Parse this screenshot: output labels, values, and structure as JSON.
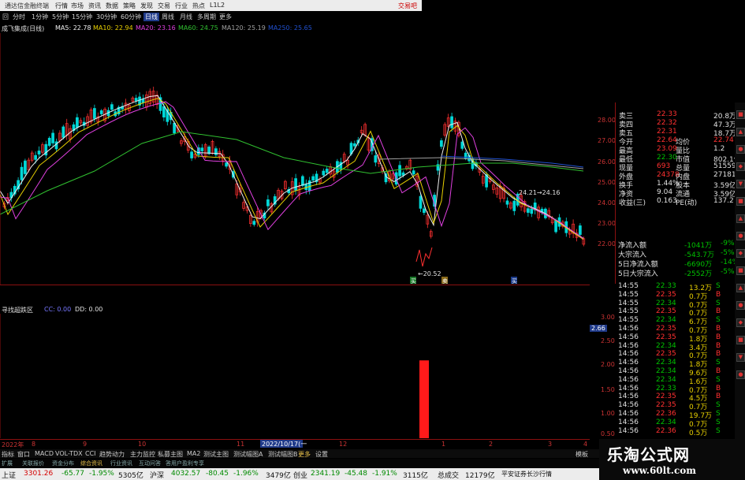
{
  "app": {
    "title": "通达信金融终端",
    "brand": "交易吧"
  },
  "menu": [
    "行情",
    "市场",
    "资讯",
    "数据",
    "策略",
    "发现",
    "交易",
    "行业",
    "热点",
    "L1L2"
  ],
  "periods": {
    "prefix": "回",
    "items": [
      "分时",
      "1分钟",
      "5分钟",
      "15分钟",
      "30分钟",
      "60分钟",
      "日线",
      "周线",
      "月线",
      "多周期",
      "更多"
    ],
    "active_index": 6
  },
  "ma_bar": {
    "stock_label": "成飞集成(日线)",
    "ma5": "MA5: 22.78",
    "ma10": "MA10: 22.94",
    "ma20": "MA20: 23.16",
    "ma60": "MA60: 24.75",
    "ma120": "MA120: 25.19",
    "ma250": "MA250: 25.65"
  },
  "colors": {
    "up": "#ff3030",
    "down": "#00d8d8",
    "ma5": "#f0f0f0",
    "ma10": "#e8d000",
    "ma20": "#e040e0",
    "ma60": "#30c030",
    "ma120": "#a0a0a0",
    "ma250": "#2050d0",
    "accent_red": "#d40000",
    "accent_green": "#008a00"
  },
  "main_chart": {
    "price_axis": [
      "28.00",
      "27.00",
      "26.00",
      "25.00",
      "24.00",
      "23.00",
      "22.00"
    ],
    "annotation_high": "24.21→24.16",
    "annotation_low": "←20.52",
    "signal_labels": [
      "买",
      "卖",
      "买"
    ]
  },
  "indicator": {
    "name": "寻找超跌区",
    "cc": "CC: 0.00",
    "dd": "DD: 0.00",
    "axis": [
      "3.00",
      "2.50",
      "2.00",
      "1.50",
      "1.00",
      "0.50"
    ],
    "current_value": "2.66",
    "bar_value": 2.0
  },
  "date_axis": {
    "labels": [
      "2022年",
      "8",
      "9",
      "10",
      "11",
      "12",
      "1",
      "2",
      "3",
      "4"
    ],
    "cursor": "2022/10/17(一"
  },
  "tabs": [
    "指标",
    "窗口",
    "MACD",
    "VOL-TDX",
    "CCI",
    "趋势动力",
    "主力监控",
    "私募主图",
    "MA2",
    "测试主图",
    "测试幅图A",
    "测试幅图B",
    "更多",
    "设置",
    "模板"
  ],
  "tabs2": [
    "扩展",
    "关联报价",
    "资金分布",
    "综合资讯",
    "行业资讯",
    "互动问答",
    "答用户盈利专享"
  ],
  "status": {
    "sh_name": "上证",
    "sh_val": "3301.26",
    "sh_chg": "-65.77",
    "sh_pct": "-1.95%",
    "sh_amt": "5305亿",
    "sz_name": "沪深",
    "sz_val": "4032.57",
    "sz_chg": "-80.45",
    "sz_pct": "-1.96%",
    "sz_amt": "3479亿",
    "cy_name": "创业",
    "cy_val": "2341.19",
    "cy_chg": "-45.48",
    "cy_pct": "-1.91%",
    "cy_amt": "3115亿",
    "total_label": "总成交",
    "total_val": "12179亿",
    "news": "平安证券长沙行情"
  },
  "quote": {
    "rows": [
      {
        "l": "卖三",
        "v": "22.33",
        "r": "",
        "rv": "20.8万"
      },
      {
        "l": "卖四",
        "v": "22.32",
        "r": "",
        "rv": "47.3万"
      },
      {
        "l": "卖五",
        "v": "22.31",
        "r": "",
        "rv": "18.7万"
      },
      {
        "l": "今开",
        "v": "22.64",
        "r": "均价",
        "rv": "22.74"
      },
      {
        "l": "最高",
        "v": "23.09",
        "r": "量比",
        "rv": "1.2"
      },
      {
        "l": "最低",
        "v": "22.30",
        "r": "市值",
        "rv": "802.1亿"
      },
      {
        "l": "现量",
        "v": "693",
        "r": "总量",
        "rv": "51559"
      },
      {
        "l": "外盘",
        "v": "24378",
        "r": "内盘",
        "rv": "27181"
      },
      {
        "l": "换手",
        "v": "1.44%",
        "r": "股本",
        "rv": "3.59亿"
      },
      {
        "l": "净资",
        "v": "9.04",
        "r": "流通",
        "rv": "3.59亿"
      },
      {
        "l": "收益(三)",
        "v": "0.163",
        "r": "PE(动)",
        "rv": "137.2"
      }
    ]
  },
  "flow": [
    {
      "l": "净流入额",
      "v": "-1041万",
      "p": "-9%"
    },
    {
      "l": "大宗流入",
      "v": "-543.7万",
      "p": "-5%"
    },
    {
      "l": "5日净流入额",
      "v": "-6690万",
      "p": "-14%"
    },
    {
      "l": "5日大宗流入",
      "v": "-2552万",
      "p": "-5%"
    }
  ],
  "ticks": [
    {
      "t": "14:55",
      "p": "22.33",
      "v": "13.2万",
      "d": "S"
    },
    {
      "t": "14:55",
      "p": "22.35",
      "v": "0.7万",
      "d": "B"
    },
    {
      "t": "14:55",
      "p": "22.34",
      "v": "0.7万",
      "d": "S"
    },
    {
      "t": "14:55",
      "p": "22.35",
      "v": "0.7万",
      "d": "B"
    },
    {
      "t": "14:55",
      "p": "22.34",
      "v": "6.7万",
      "d": "S"
    },
    {
      "t": "14:56",
      "p": "22.35",
      "v": "0.7万",
      "d": "B"
    },
    {
      "t": "14:56",
      "p": "22.35",
      "v": "1.8万",
      "d": "B"
    },
    {
      "t": "14:56",
      "p": "22.34",
      "v": "3.4万",
      "d": "B"
    },
    {
      "t": "14:56",
      "p": "22.35",
      "v": "0.7万",
      "d": "B"
    },
    {
      "t": "14:56",
      "p": "22.34",
      "v": "1.8万",
      "d": "S"
    },
    {
      "t": "14:56",
      "p": "22.34",
      "v": "9.6万",
      "d": "B"
    },
    {
      "t": "14:56",
      "p": "22.34",
      "v": "1.6万",
      "d": "S"
    },
    {
      "t": "14:56",
      "p": "22.33",
      "v": "0.7万",
      "d": "B"
    },
    {
      "t": "14:56",
      "p": "22.35",
      "v": "4.5万",
      "d": "B"
    },
    {
      "t": "14:56",
      "p": "22.35",
      "v": "0.7万",
      "d": "S"
    },
    {
      "t": "14:56",
      "p": "22.36",
      "v": "19.7万",
      "d": "S"
    },
    {
      "t": "14:56",
      "p": "22.34",
      "v": "0.7万",
      "d": "S"
    },
    {
      "t": "14:56",
      "p": "22.36",
      "v": "0.5万",
      "d": "S"
    }
  ],
  "watermark": {
    "title": "乐淘公式网",
    "url": "www.60lt.com"
  }
}
